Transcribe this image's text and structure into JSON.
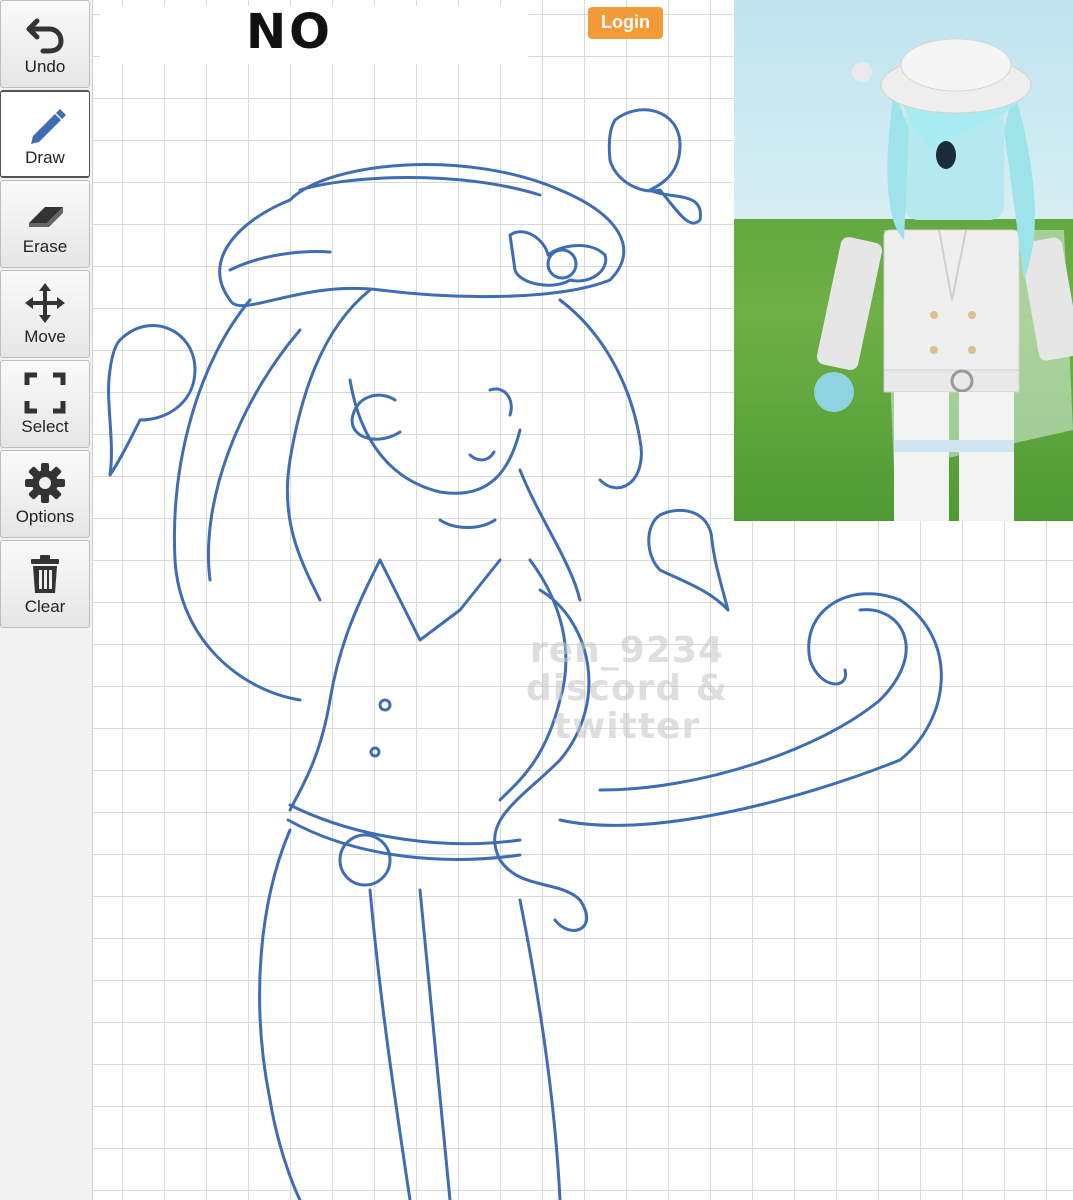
{
  "toolbar": {
    "items": [
      {
        "label": "Undo",
        "icon": "undo-icon"
      },
      {
        "label": "Draw",
        "icon": "pencil-icon",
        "active": true
      },
      {
        "label": "Erase",
        "icon": "eraser-icon"
      },
      {
        "label": "Move",
        "icon": "move-arrows-icon"
      },
      {
        "label": "Select",
        "icon": "select-frame-icon"
      },
      {
        "label": "Options",
        "icon": "gear-icon"
      },
      {
        "label": "Clear",
        "icon": "trash-icon"
      }
    ]
  },
  "canvas": {
    "title": "NO",
    "watermark_lines": [
      "ren_9234",
      "discord &",
      "twitter"
    ]
  },
  "header": {
    "login_label": "Login"
  },
  "colors": {
    "stroke": "#3f6db3",
    "login": "#f29b38",
    "grass": "#63a842",
    "sky": "#cce8f0",
    "avatar_hair": "#9ee3ea"
  }
}
